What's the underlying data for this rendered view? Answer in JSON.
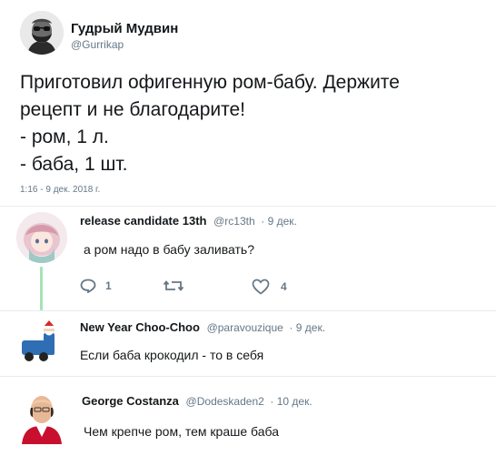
{
  "main_tweet": {
    "author_name": "Гудрый Мудвин",
    "author_handle": "@Gurrikap",
    "text_lines": [
      "Приготовил офигенную ром-бабу. Держите",
      "рецепт и не благодарите!",
      "- ром, 1 л.",
      "- баба, 1 шт."
    ],
    "timestamp": "1:16 - 9 дек. 2018 г."
  },
  "replies": [
    {
      "author_name": "release candidate 13th",
      "author_handle": "@rc13th",
      "date": "· 9 дек.",
      "text": "а ром надо в бабу заливать?",
      "reply_count": "1",
      "retweet_count": "",
      "like_count": "4"
    },
    {
      "author_name": "New Year Choo-Choo",
      "author_handle": "@paravouzique",
      "date": "· 9 дек.",
      "text": "Если баба крокодил - то в себя"
    },
    {
      "author_name": "George Costanza",
      "author_handle": "@Dodeskaden2",
      "date": "· 10 дек.",
      "text": "Чем крепче ром, тем краше баба"
    }
  ],
  "icons": {
    "reply": "comment-bubble-icon",
    "retweet": "retweet-icon",
    "like": "heart-icon"
  },
  "colors": {
    "text": "#14171a",
    "secondary": "#657786",
    "separator": "#e6ecf0",
    "thread_line": "#a6e3b3"
  }
}
